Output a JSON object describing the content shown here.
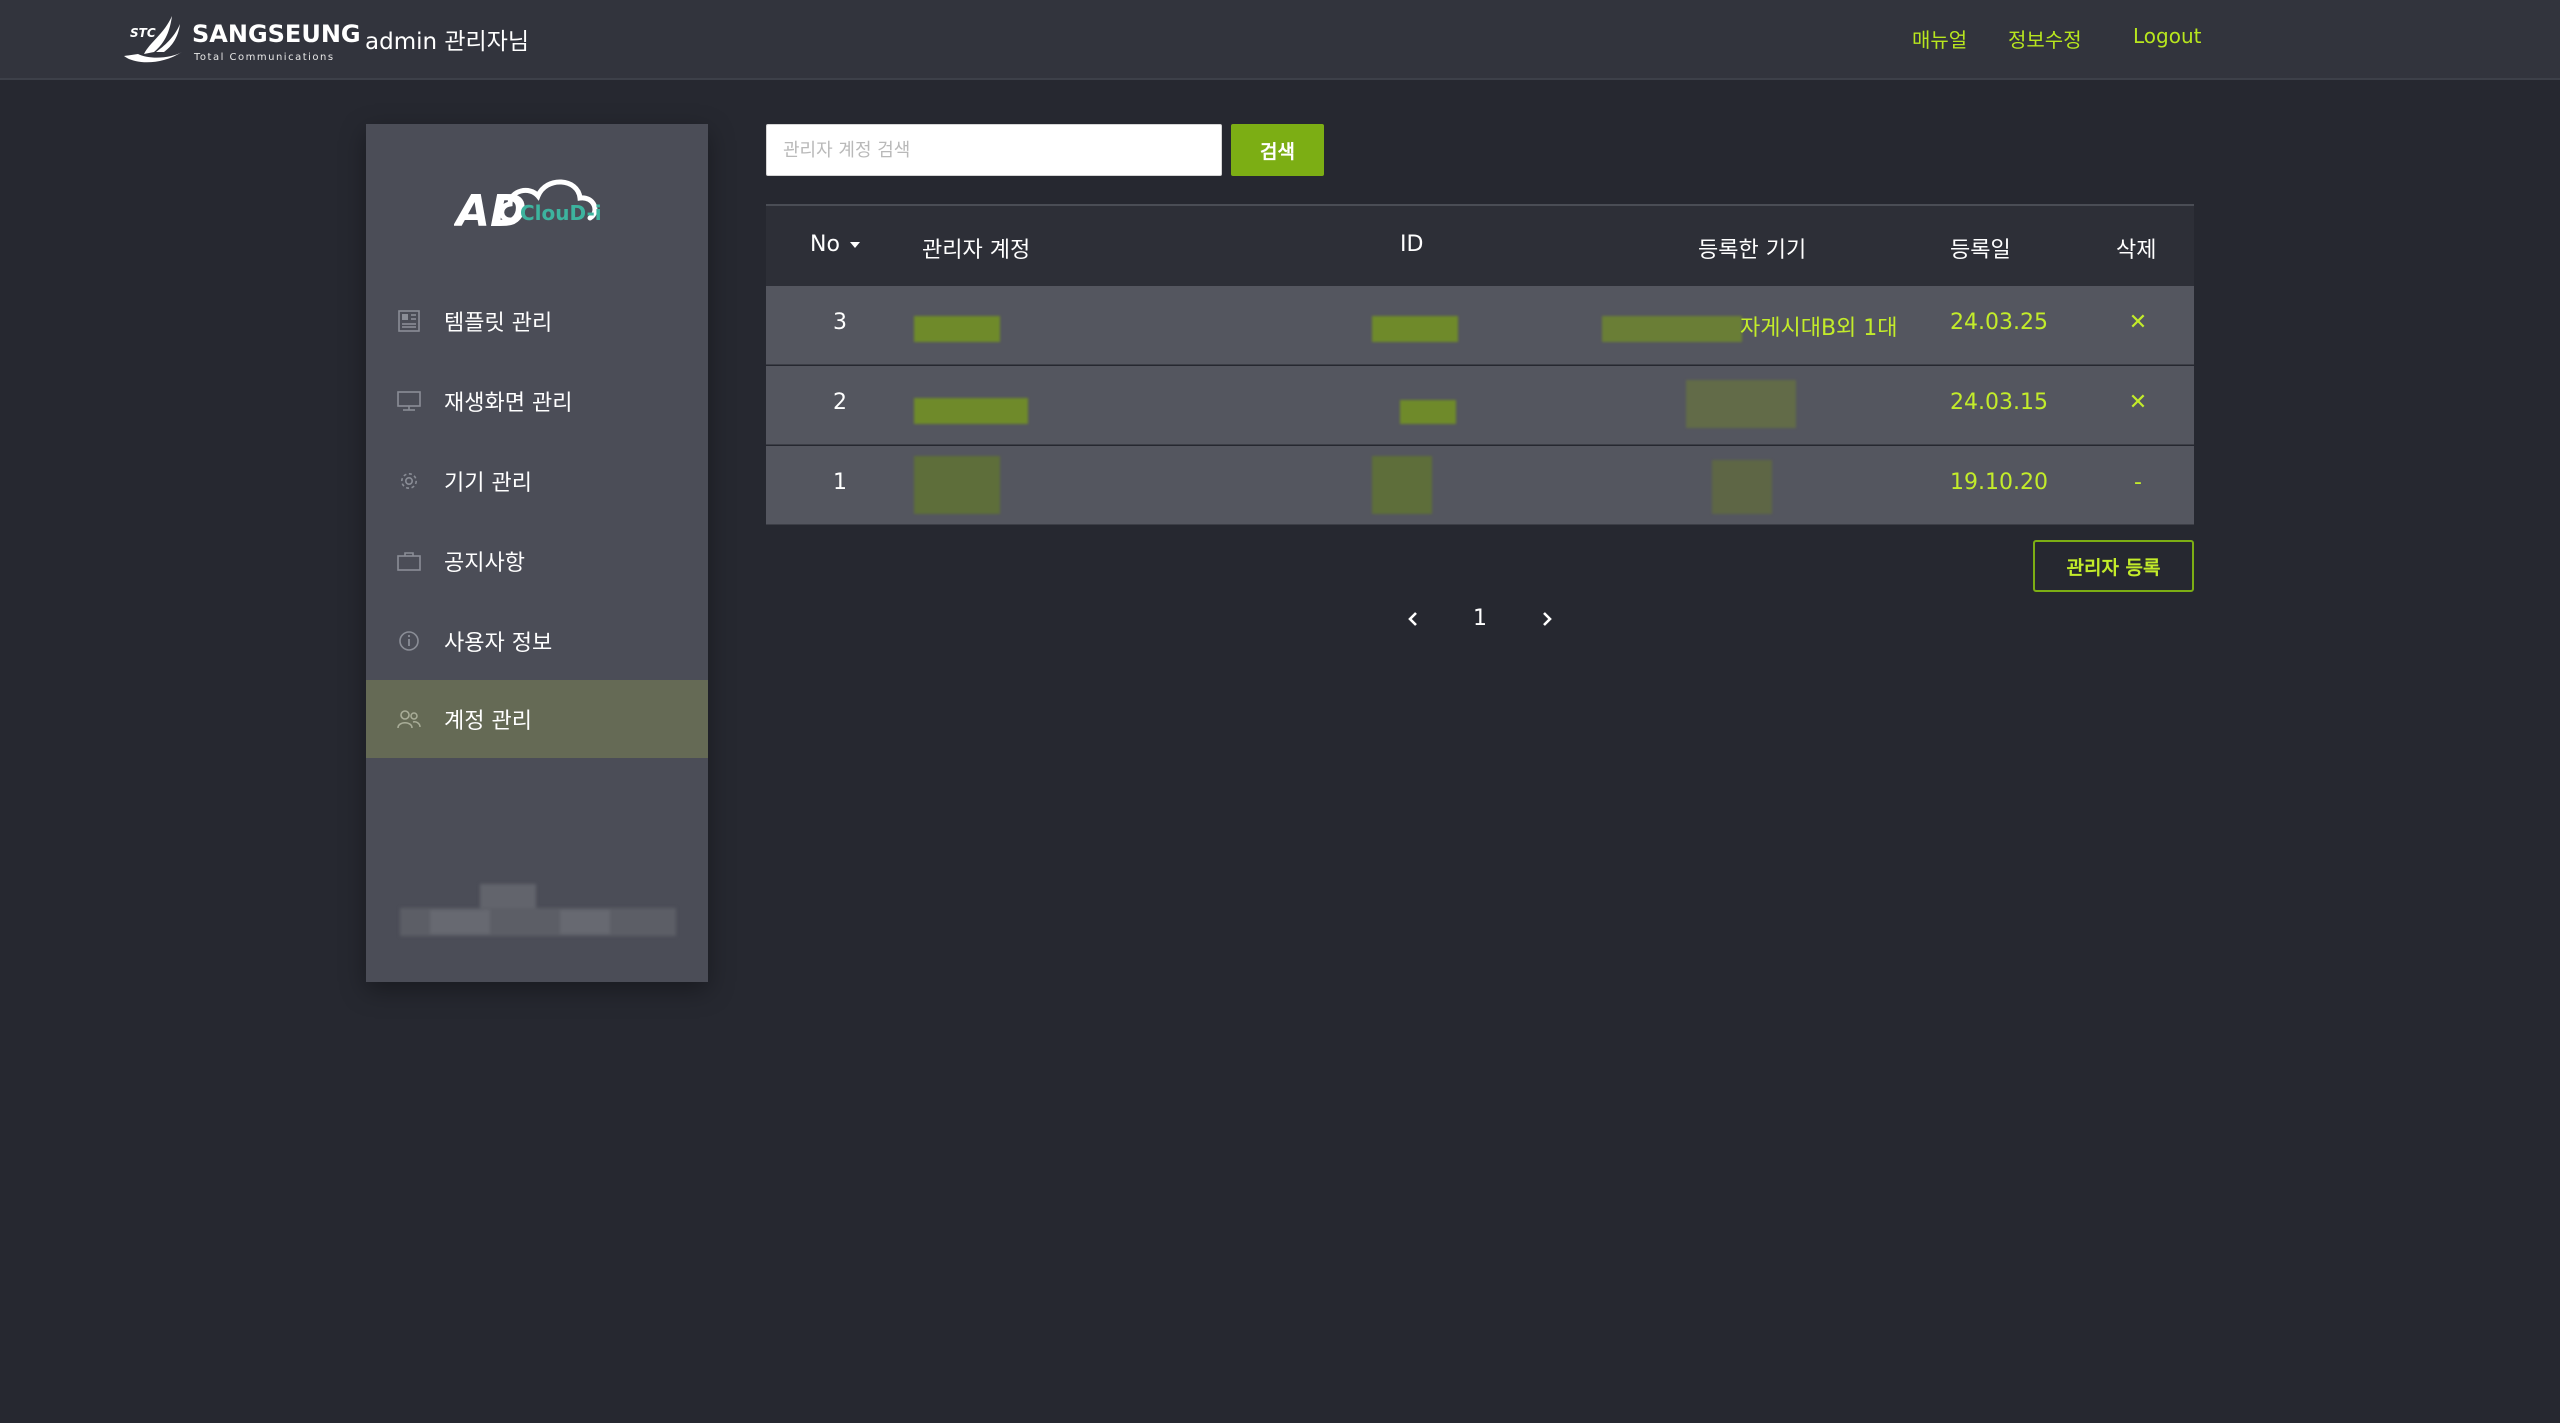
{
  "header": {
    "brand": {
      "mark_text": "STC",
      "name": "SANGSEUNG",
      "tagline": "Total Communications"
    },
    "greeting": "admin 관리자님",
    "links": [
      {
        "label": "매뉴얼"
      },
      {
        "label": "정보수정"
      },
      {
        "label": "Logout"
      }
    ]
  },
  "sidebar": {
    "logo": {
      "big": "AD",
      "small": "ClouD-i"
    },
    "items": [
      {
        "label": "템플릿 관리",
        "icon": "template-icon",
        "active": false
      },
      {
        "label": "재생화면 관리",
        "icon": "monitor-icon",
        "active": false
      },
      {
        "label": "기기 관리",
        "icon": "gear-icon",
        "active": false
      },
      {
        "label": "공지사항",
        "icon": "briefcase-icon",
        "active": false
      },
      {
        "label": "사용자 정보",
        "icon": "info-icon",
        "active": false
      },
      {
        "label": "계정 관리",
        "icon": "users-icon",
        "active": true
      }
    ]
  },
  "search": {
    "placeholder": "관리자 계정 검색",
    "value": "",
    "button_label": "검색"
  },
  "table": {
    "columns": [
      "No",
      "관리자 계정",
      "ID",
      "등록한 기기",
      "등록일",
      "삭제"
    ],
    "rows": [
      {
        "no": "3",
        "device": "자게시대B외 1대",
        "date": "24.03.25",
        "delete": "✕"
      },
      {
        "no": "2",
        "device": "",
        "date": "24.03.15",
        "delete": "✕"
      },
      {
        "no": "1",
        "device": "",
        "date": "19.10.20",
        "delete": "-"
      }
    ]
  },
  "register_button": "관리자 등록",
  "pagination": {
    "current": "1"
  },
  "colors": {
    "accent": "#7cae14",
    "accent_text": "#c3ec2a",
    "link": "#b8e61e",
    "background": "#262830",
    "sidebar": "#4b4d57",
    "active_item": "#656a55"
  }
}
